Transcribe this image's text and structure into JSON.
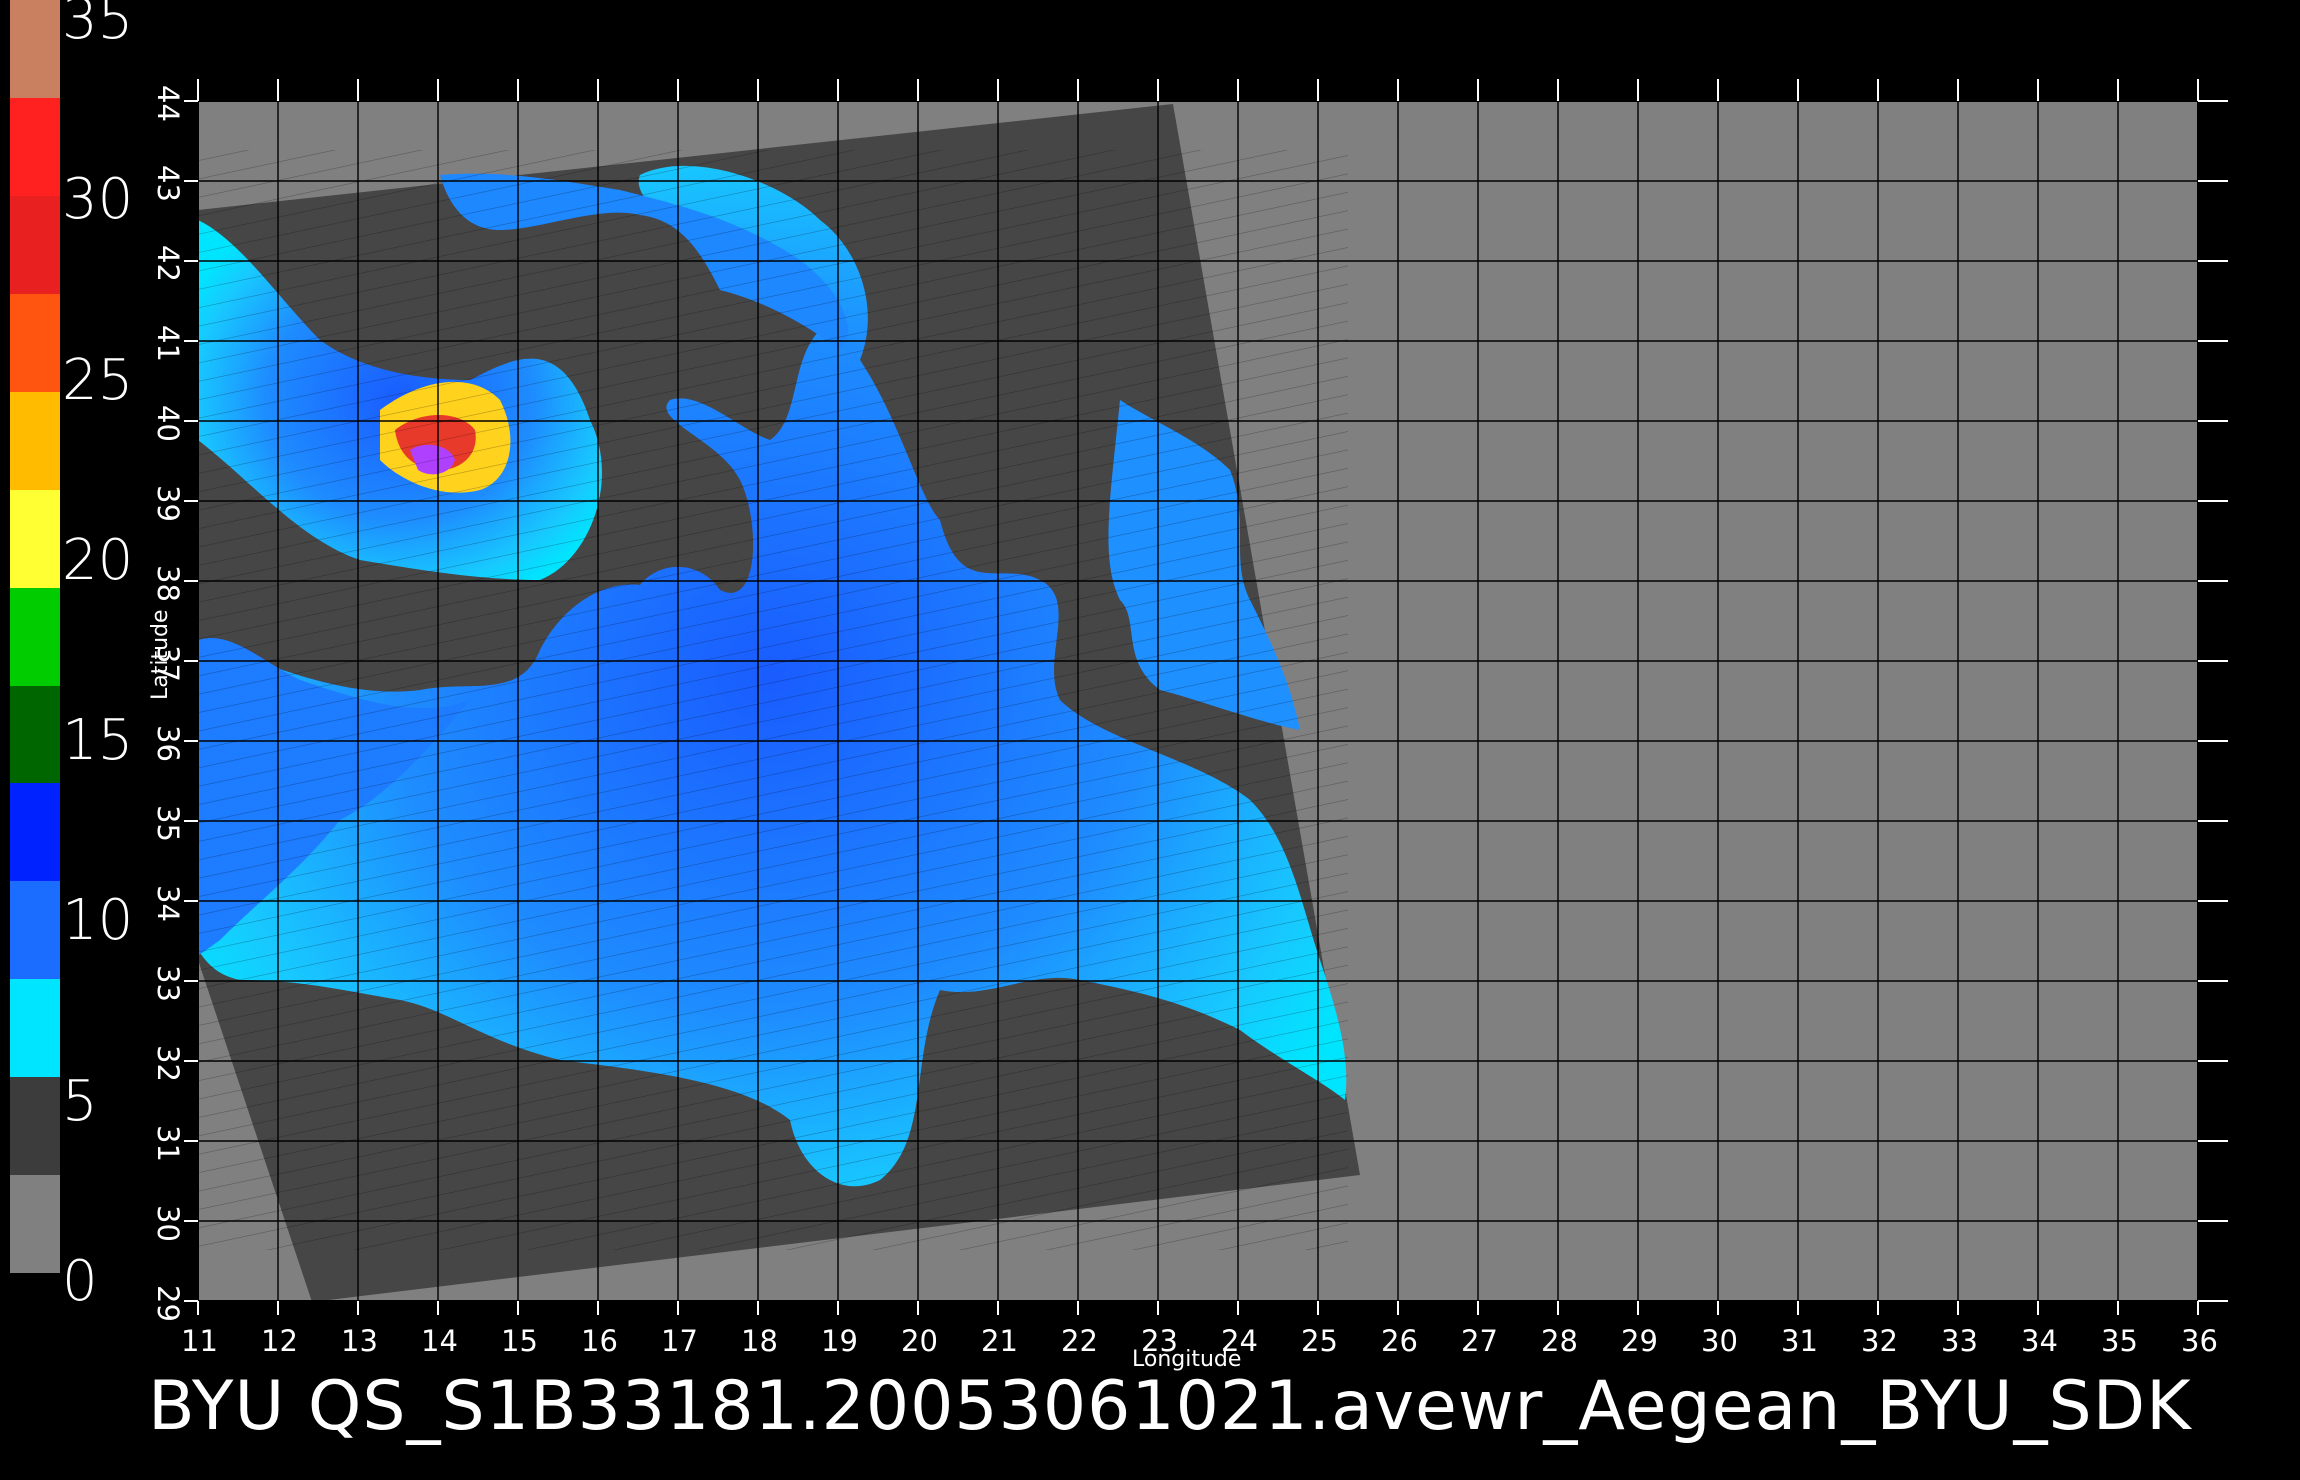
{
  "title": "BYU  QS_S1B33181.20053061021.avewr_Aegean_BYU_SDK",
  "colorbar": {
    "ticks": [
      "0",
      "5",
      "10",
      "15",
      "20",
      "25",
      "30",
      "35"
    ],
    "colors": [
      "#808080",
      "#3c3c3c",
      "#00e5ff",
      "#1a6dff",
      "#0022ff",
      "#006600",
      "#00cc00",
      "#ffff33",
      "#ffbb00",
      "#ff5511",
      "#e82020",
      "#ff2020",
      "#c88060"
    ]
  },
  "map": {
    "xlabel": "Longitude",
    "ylabel": "Latitude",
    "lon_ticks": [
      "11",
      "12",
      "13",
      "14",
      "15",
      "16",
      "17",
      "18",
      "19",
      "20",
      "21",
      "22",
      "23",
      "24",
      "25",
      "26",
      "27",
      "28",
      "29",
      "30",
      "31",
      "32",
      "33",
      "34",
      "35",
      "36"
    ],
    "lat_ticks": [
      "29",
      "30",
      "31",
      "32",
      "33",
      "34",
      "35",
      "36",
      "37",
      "38",
      "39",
      "40",
      "41",
      "42",
      "43",
      "44"
    ],
    "lon_range": [
      11,
      36
    ],
    "lat_range": [
      29,
      44
    ],
    "grid": true,
    "colors": {
      "no_data": "#808080",
      "land": "#464646",
      "background": "#000000"
    }
  }
}
